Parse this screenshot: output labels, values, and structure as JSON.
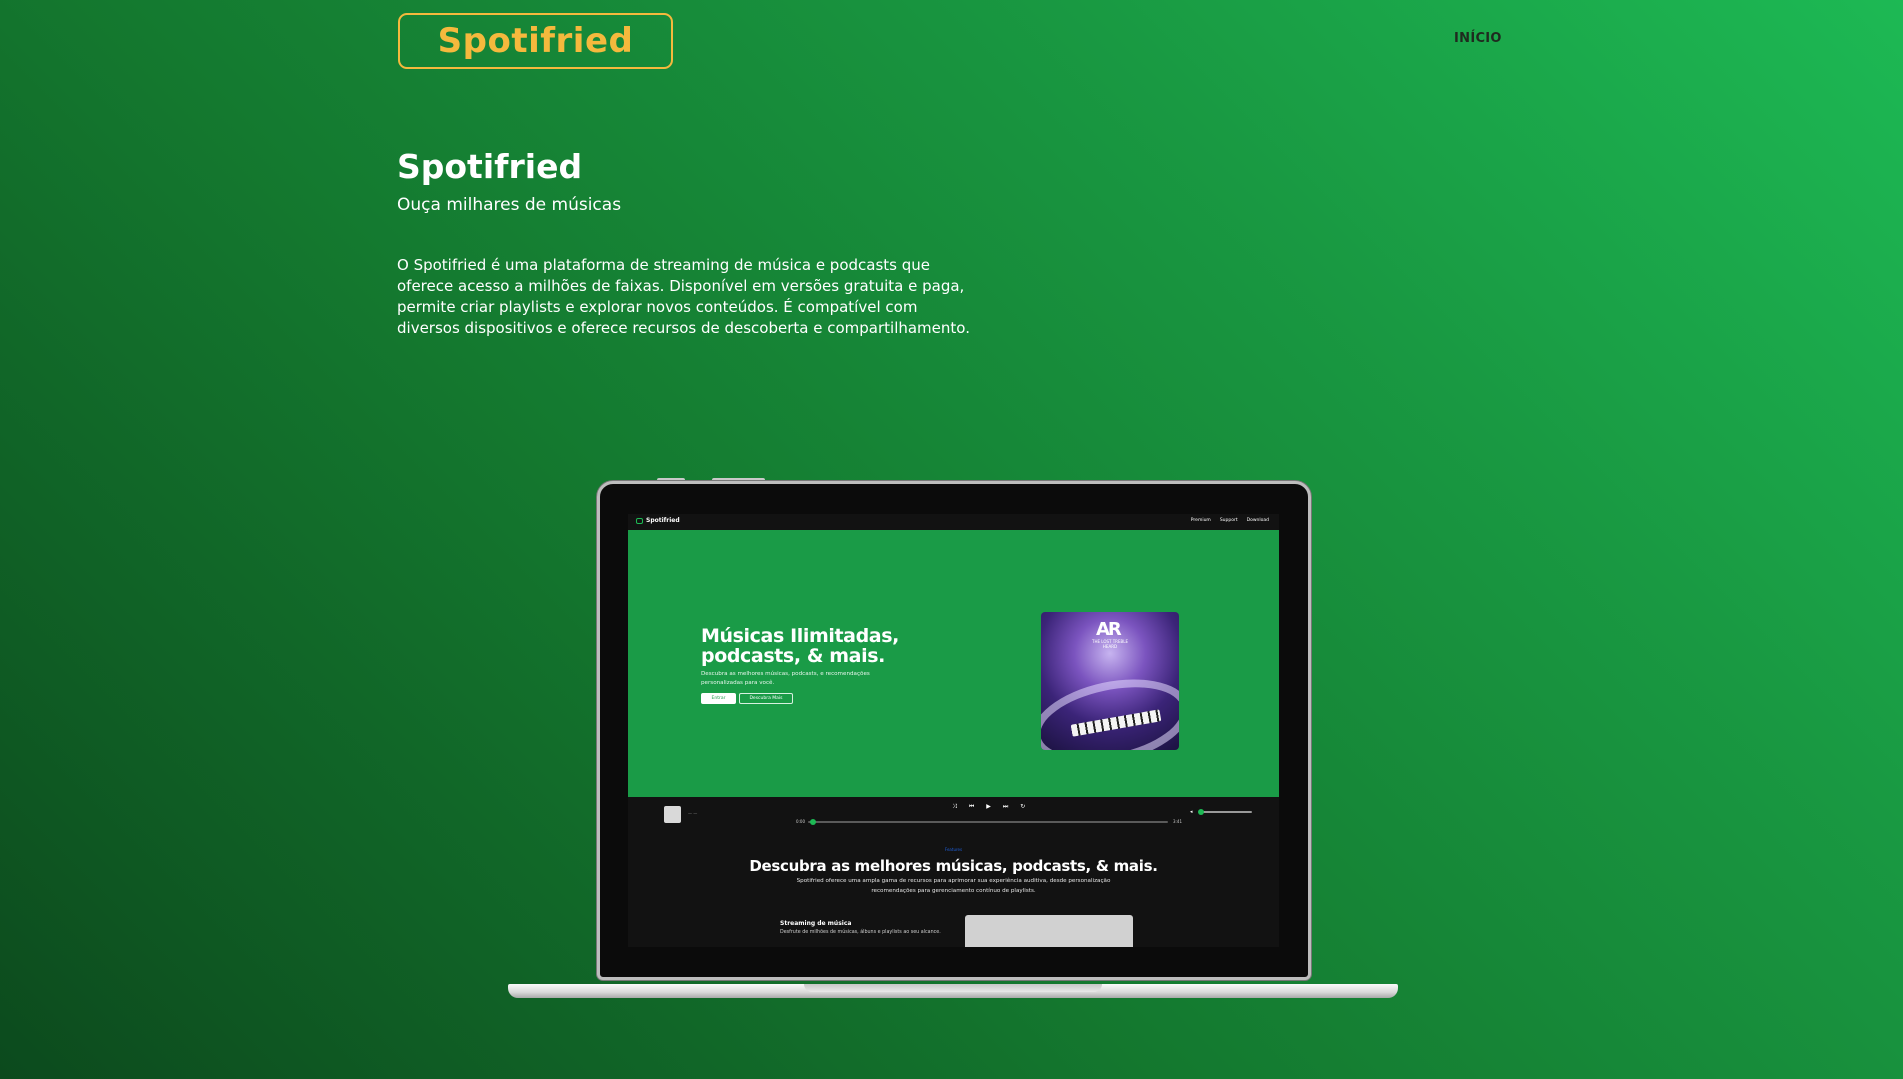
{
  "header": {
    "logo": "Spotifried",
    "nav_link": "INÍCIO"
  },
  "hero": {
    "title": "Spotifried",
    "subtitle": "Ouça milhares de músicas",
    "description": "O Spotifried é uma plataforma de streaming de música e podcasts que oferece acesso a milhões de faixas. Disponível em versões gratuita e paga, permite criar playlists e explorar novos conteúdos. É compatível com diversos dispositivos e oferece recursos de descoberta e compartilhamento."
  },
  "screen": {
    "brand": "Spotifried",
    "links": [
      "Premium",
      "Support",
      "Download"
    ],
    "hero_title": "Músicas Ilimitadas, podcasts, & mais.",
    "hero_text": "Descubra as melhores músicas, podcasts, e recomendações personalizadas para você.",
    "btn_primary": "Entrar",
    "btn_secondary": "Descubra Mais",
    "album_mono": "AR",
    "album_sub": "THE LOST TREBLE HEARD",
    "player": {
      "track": "— —",
      "time_current": "0:00",
      "time_total": "3:41",
      "controls": [
        "shuffle-icon",
        "previous-icon",
        "play-icon",
        "next-icon",
        "repeat-icon"
      ]
    },
    "section_tag": "Features",
    "section_title": "Descubra as melhores músicas, podcasts, & mais.",
    "section_desc": "Spotifried oferece uma ampla gama de recursos para aprimorar sua experiência auditiva, desde personalização recomendações para gerenciamento contínuo de playlists.",
    "feature_title": "Streaming de música",
    "feature_desc": "Desfrute de milhões de músicas, álbuns e playlists ao seu alcance."
  },
  "colors": {
    "accent": "#f5b93d",
    "brand_green": "#1db954",
    "hero_green": "#1a9b47"
  }
}
